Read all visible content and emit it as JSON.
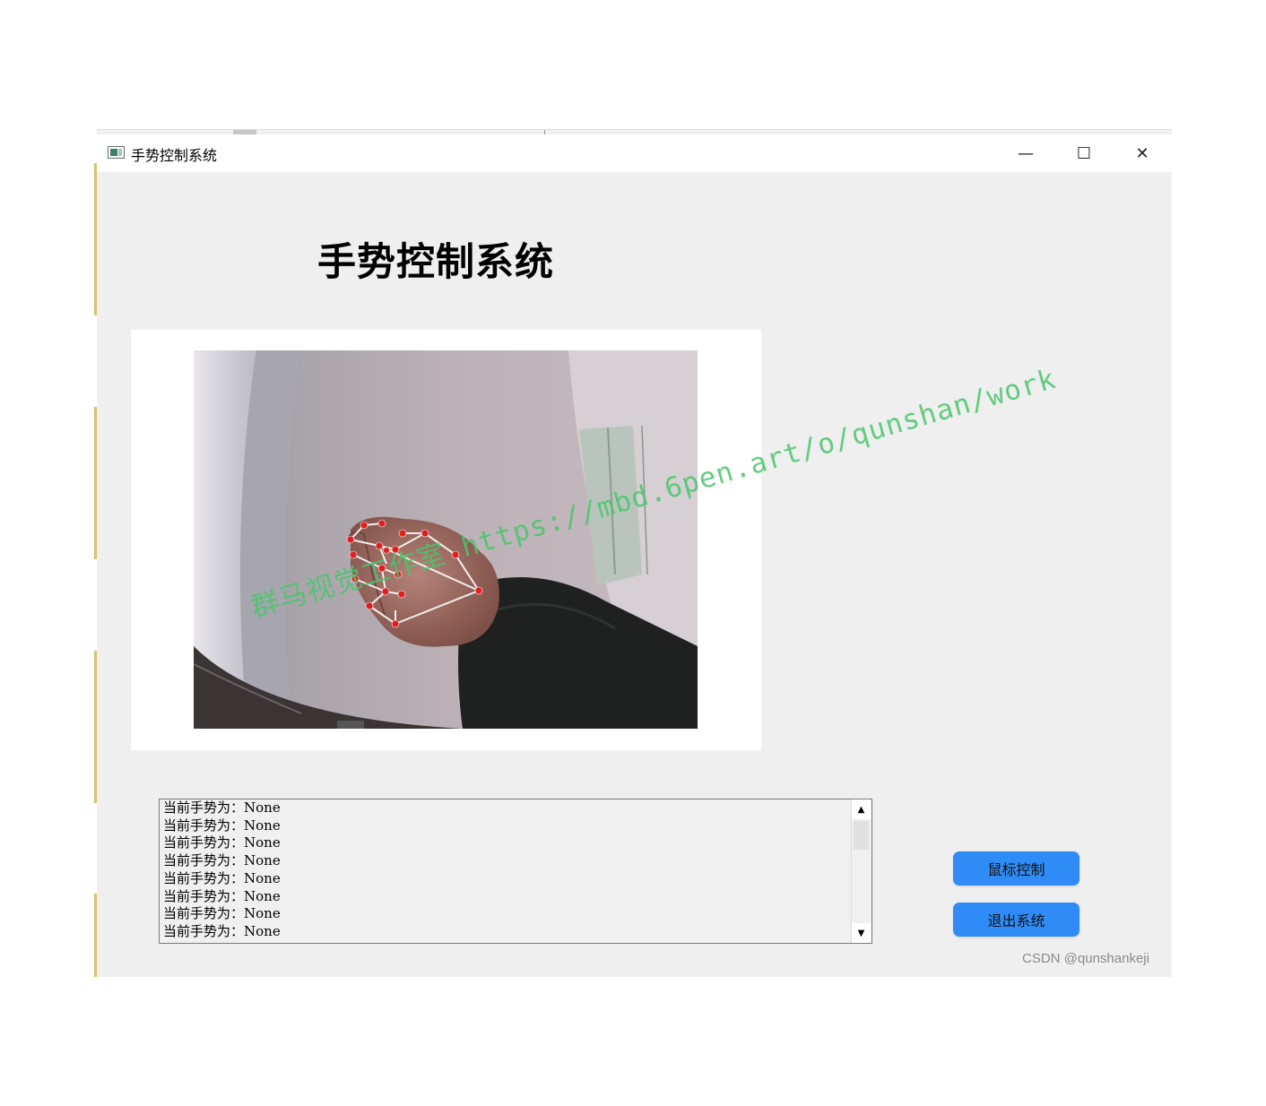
{
  "window": {
    "title": "手势控制系统",
    "controls": {
      "minimize": "—",
      "maximize": "☐",
      "close": "✕"
    }
  },
  "main": {
    "heading": "手势控制系统",
    "log": {
      "lines": [
        "当前手势为：None",
        "当前手势为：None",
        "当前手势为：None",
        "当前手势为：None",
        "当前手势为：None",
        "当前手势为：None",
        "当前手势为：None",
        "当前手势为：None"
      ],
      "scroll_up": "▲",
      "scroll_down": "▼"
    },
    "buttons": {
      "mouse_control": "鼠标控制",
      "exit_system": "退出系统"
    }
  },
  "overlay": {
    "watermark": "群马视觉工作室 https://mbd.6pen.art/o/qunshan/work",
    "credit": "CSDN @qunshankeji"
  },
  "colors": {
    "button_blue": "#2f8cf7",
    "window_bg": "#efefef",
    "watermark_green": "#48c66c",
    "landmark_red": "#e02020"
  },
  "icons": {
    "app": "app-window-icon",
    "minimize": "minimize-icon",
    "maximize": "maximize-icon",
    "close": "close-icon"
  }
}
